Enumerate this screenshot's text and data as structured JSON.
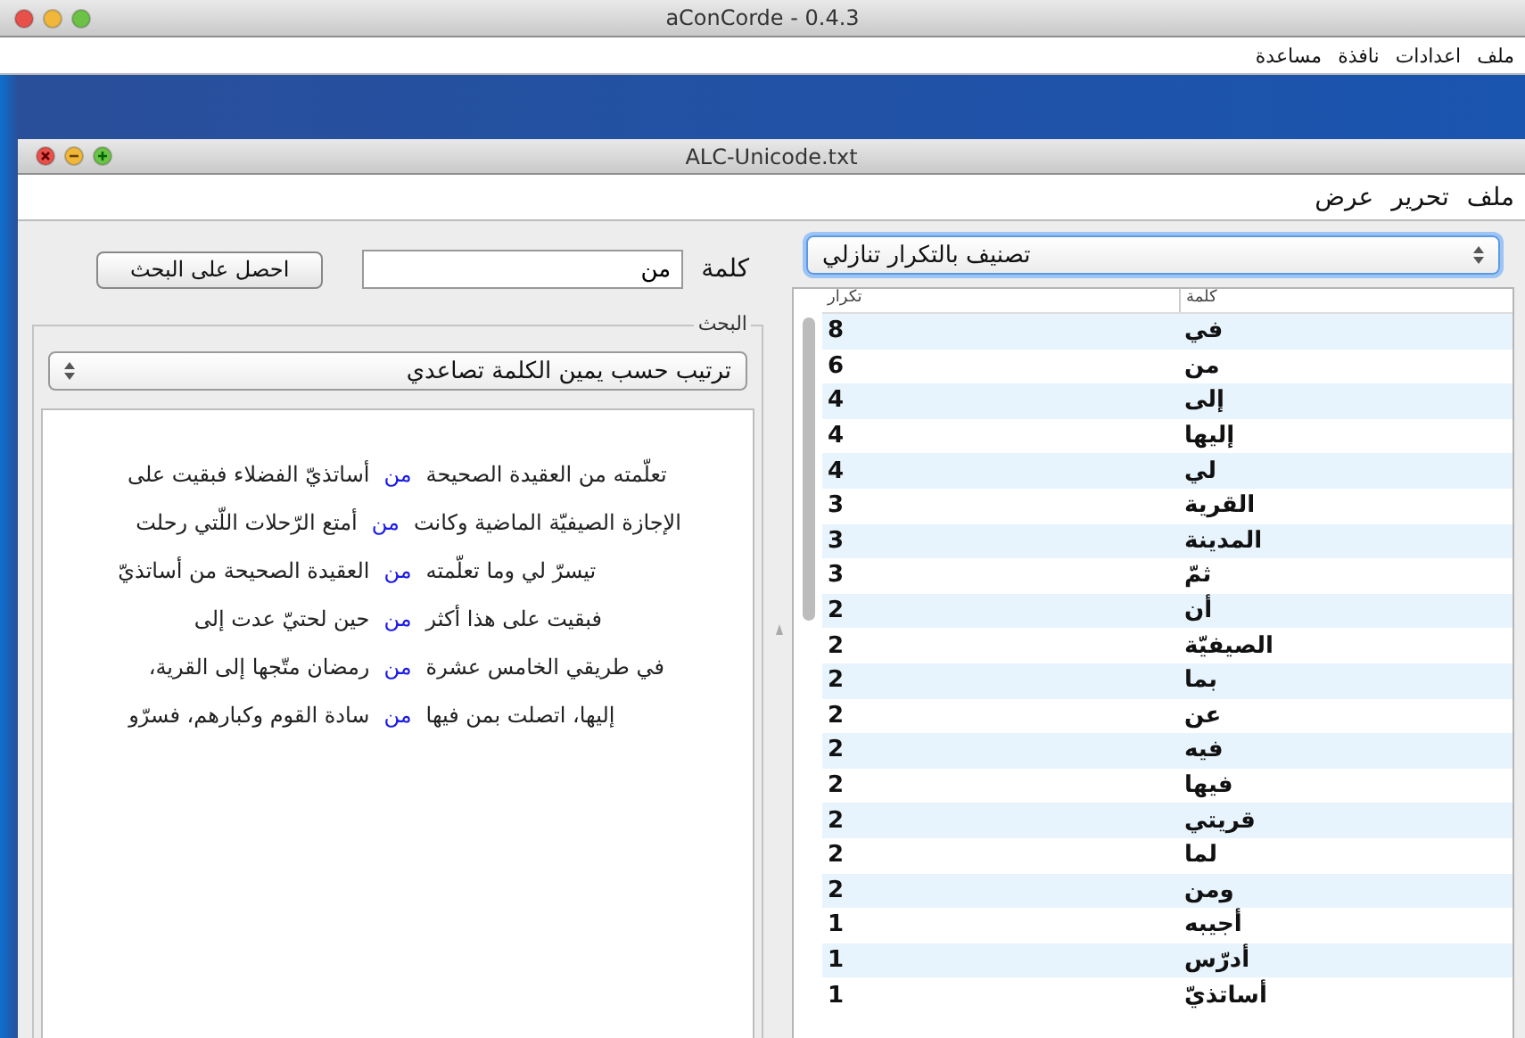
{
  "app_window": {
    "title": "aConCorde - 0.4.3",
    "menu": [
      "ملف",
      "اعدادات",
      "نافذة",
      "مساعدة"
    ]
  },
  "document_window": {
    "title": "ALC-Unicode.txt",
    "menu": [
      "ملف",
      "تحرير",
      "عرض"
    ]
  },
  "search": {
    "label": "كلمة",
    "value": "من",
    "button": "احصل على البحث"
  },
  "results_group": {
    "title": "البحث",
    "sort": {
      "value": "ترتيب حسب يمين الكلمة تصاعدي",
      "focused": false
    },
    "lines": [
      {
        "before": "تعلّمته من العقيدة الصحيحة",
        "keyword": "من",
        "after": "أساتذيّ الفضلاء فبقيت على"
      },
      {
        "before": "الإجازة الصيفيّة الماضية وكانت",
        "keyword": "من",
        "after": "أمتع الرّحلات اللّتي رحلت"
      },
      {
        "before": "تيسرّ لي وما تعلّمته",
        "keyword": "من",
        "after": "العقيدة الصحيحة من أساتذيّ"
      },
      {
        "before": "فبقيت على هذا أكثر",
        "keyword": "من",
        "after": "حين لحتيّ عدت إلى"
      },
      {
        "before": "في طريقي الخامس عشرة",
        "keyword": "من",
        "after": "رمضان متّجها إلى القرية،"
      },
      {
        "before": "إليها، اتصلت بمن فيها",
        "keyword": "من",
        "after": "سادة القوم وكبارهم، فسرّو"
      }
    ]
  },
  "frequency": {
    "sort": {
      "value": "تصنيف بالتكرار تنازلي",
      "focused": true
    },
    "columns": [
      "كلمة",
      "تكرار"
    ],
    "rows": [
      {
        "count": "8",
        "word": "في"
      },
      {
        "count": "6",
        "word": "من"
      },
      {
        "count": "4",
        "word": "إلى"
      },
      {
        "count": "4",
        "word": "إليها"
      },
      {
        "count": "4",
        "word": "لي"
      },
      {
        "count": "3",
        "word": "القرية"
      },
      {
        "count": "3",
        "word": "المدينة"
      },
      {
        "count": "3",
        "word": "ثمّ"
      },
      {
        "count": "2",
        "word": "أن"
      },
      {
        "count": "2",
        "word": "الصيفيّة"
      },
      {
        "count": "2",
        "word": "بما"
      },
      {
        "count": "2",
        "word": "عن"
      },
      {
        "count": "2",
        "word": "فيه"
      },
      {
        "count": "2",
        "word": "فيها"
      },
      {
        "count": "2",
        "word": "قريتي"
      },
      {
        "count": "2",
        "word": "لما"
      },
      {
        "count": "2",
        "word": "ومن"
      },
      {
        "count": "1",
        "word": "أجيبه"
      },
      {
        "count": "1",
        "word": "أدرّس"
      },
      {
        "count": "1",
        "word": "أساتذيّ"
      }
    ]
  }
}
